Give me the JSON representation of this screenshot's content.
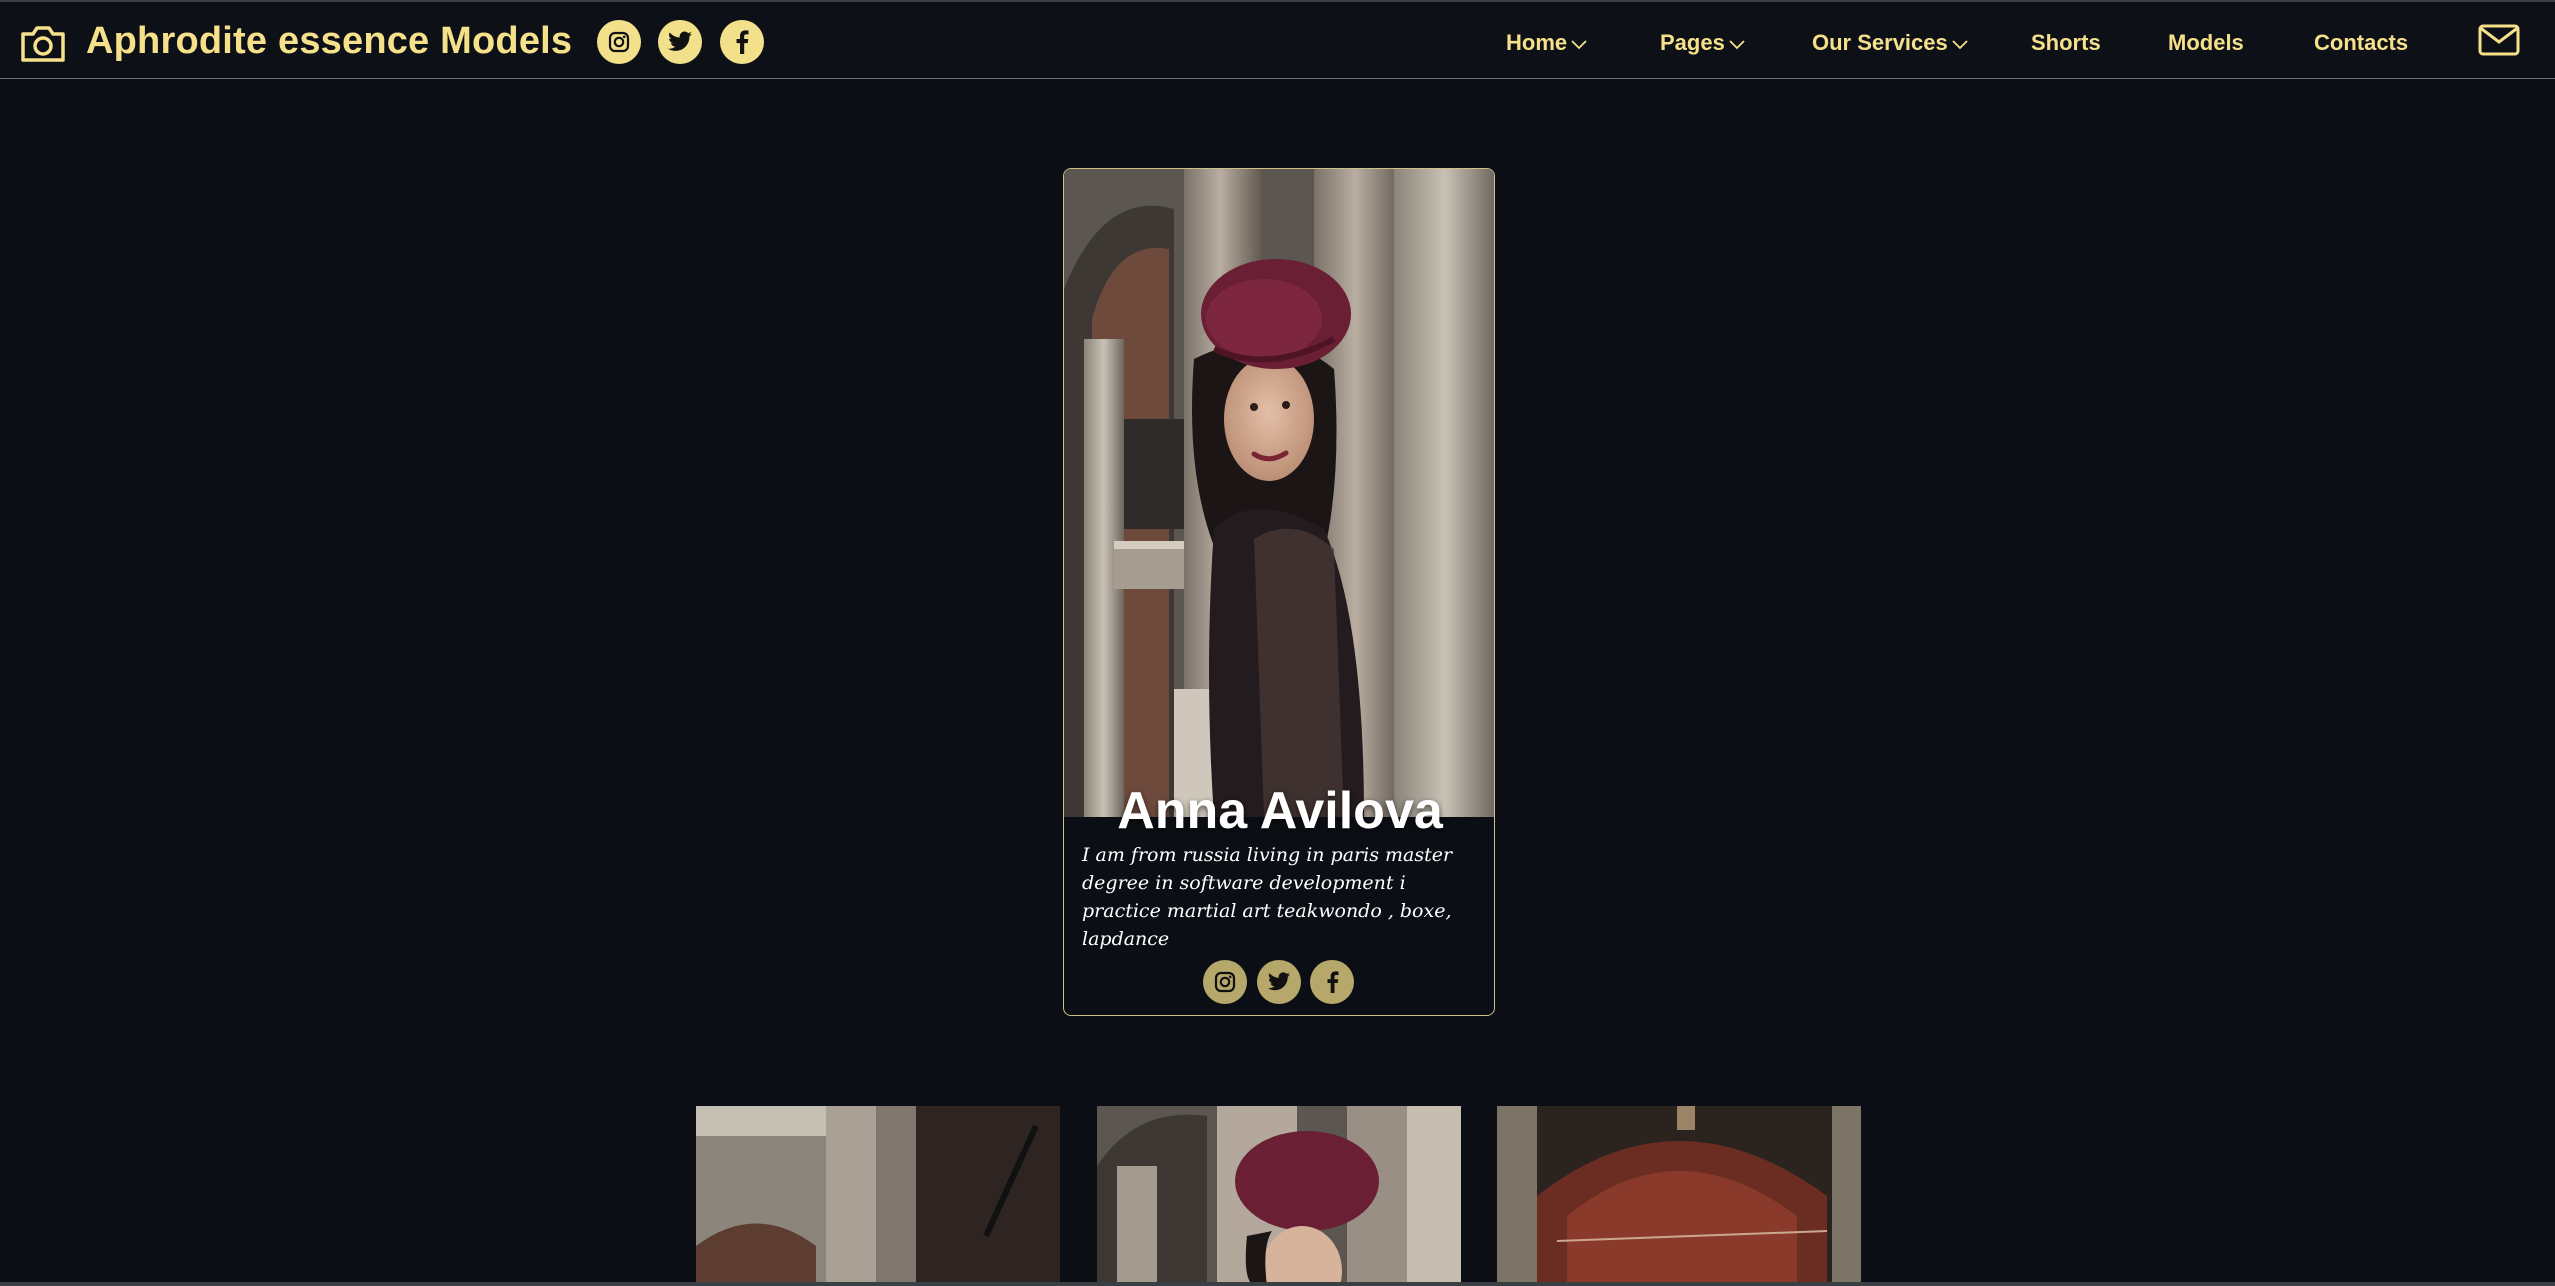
{
  "header": {
    "brand_title": "Aphrodite essence Models",
    "brand_icon": "camera-icon",
    "socials": [
      "instagram-icon",
      "twitter-icon",
      "facebook-icon"
    ],
    "nav": [
      {
        "label": "Home",
        "dropdown": true
      },
      {
        "label": "Pages",
        "dropdown": true
      },
      {
        "label": "Our Services",
        "dropdown": true
      },
      {
        "label": "Shorts",
        "dropdown": false
      },
      {
        "label": "Models",
        "dropdown": false
      },
      {
        "label": "Contacts",
        "dropdown": false
      }
    ],
    "mail_icon": "envelope-icon"
  },
  "card": {
    "name": "Anna Avilova",
    "bio": "I am from russia living in paris master degree in software development i practice martial art teakwondo , boxe, lapdance",
    "socials": [
      "instagram-icon",
      "twitter-icon",
      "facebook-icon"
    ]
  },
  "colors": {
    "background": "#0b0f15",
    "accent": "#f6e08a",
    "card_border": "#cdbf86",
    "card_social_bg": "#b5a86a"
  }
}
